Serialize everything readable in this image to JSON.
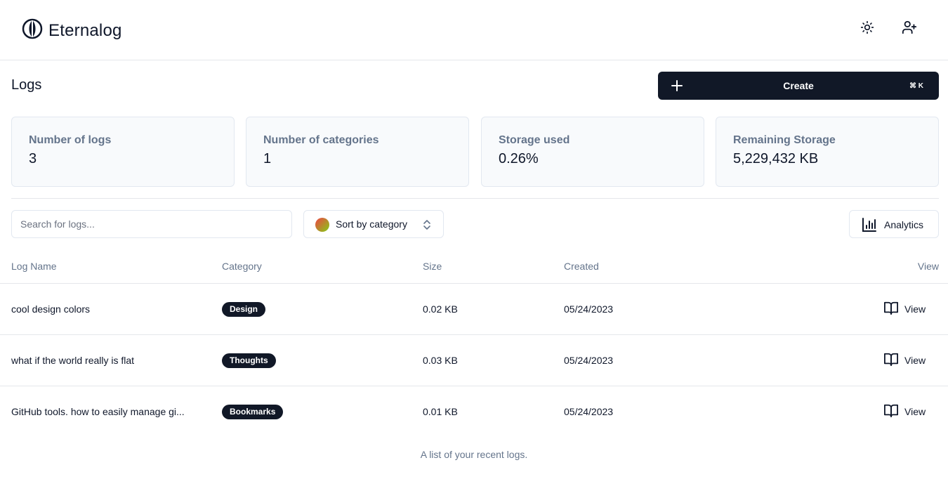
{
  "app": {
    "name": "Eternalog"
  },
  "header": {
    "icons": [
      "logo-icon",
      "sun-icon",
      "user-plus-icon"
    ]
  },
  "page": {
    "title": "Logs",
    "create_label": "Create",
    "create_shortcut": "⌘ K"
  },
  "stats": [
    {
      "label": "Number of logs",
      "value": "3"
    },
    {
      "label": "Number of categories",
      "value": "1"
    },
    {
      "label": "Storage used",
      "value": "0.26%"
    },
    {
      "label": "Remaining Storage",
      "value": "5,229,432 KB"
    }
  ],
  "toolbar": {
    "search_placeholder": "Search for logs...",
    "search_value": "",
    "sort_label": "Sort by category",
    "analytics_label": "Analytics"
  },
  "table": {
    "columns": [
      "Log Name",
      "Category",
      "Size",
      "Created",
      "View"
    ],
    "rows": [
      {
        "name": "cool design colors",
        "category": "Design",
        "size": "0.02 KB",
        "created": "05/24/2023",
        "action": "View"
      },
      {
        "name": "what if the world really is flat",
        "category": "Thoughts",
        "size": "0.03 KB",
        "created": "05/24/2023",
        "action": "View"
      },
      {
        "name": "GitHub tools. how to easily manage gi...",
        "category": "Bookmarks",
        "size": "0.01 KB",
        "created": "05/24/2023",
        "action": "View"
      }
    ],
    "caption": "A list of your recent logs."
  },
  "colors": {
    "primary": "#111827",
    "muted_text": "#64748b",
    "card_bg": "#f8fafc",
    "border": "#e2e8f0"
  }
}
